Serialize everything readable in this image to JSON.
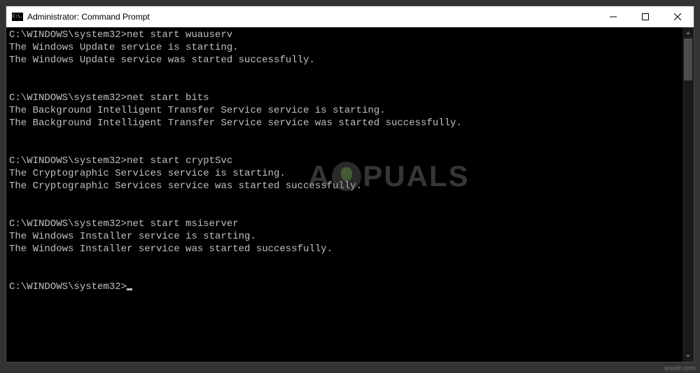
{
  "window": {
    "title": "Administrator: Command Prompt",
    "icon_label": "C:\\."
  },
  "terminal": {
    "prompt": "C:\\WINDOWS\\system32>",
    "lines": [
      {
        "type": "cmd",
        "text": "C:\\WINDOWS\\system32>net start wuauserv"
      },
      {
        "type": "out",
        "text": "The Windows Update service is starting."
      },
      {
        "type": "out",
        "text": "The Windows Update service was started successfully."
      },
      {
        "type": "blank",
        "text": ""
      },
      {
        "type": "blank",
        "text": ""
      },
      {
        "type": "cmd",
        "text": "C:\\WINDOWS\\system32>net start bits"
      },
      {
        "type": "out",
        "text": "The Background Intelligent Transfer Service service is starting."
      },
      {
        "type": "out",
        "text": "The Background Intelligent Transfer Service service was started successfully."
      },
      {
        "type": "blank",
        "text": ""
      },
      {
        "type": "blank",
        "text": ""
      },
      {
        "type": "cmd",
        "text": "C:\\WINDOWS\\system32>net start cryptSvc"
      },
      {
        "type": "out",
        "text": "The Cryptographic Services service is starting."
      },
      {
        "type": "out",
        "text": "The Cryptographic Services service was started successfully."
      },
      {
        "type": "blank",
        "text": ""
      },
      {
        "type": "blank",
        "text": ""
      },
      {
        "type": "cmd",
        "text": "C:\\WINDOWS\\system32>net start msiserver"
      },
      {
        "type": "out",
        "text": "The Windows Installer service is starting."
      },
      {
        "type": "out",
        "text": "The Windows Installer service was started successfully."
      },
      {
        "type": "blank",
        "text": ""
      },
      {
        "type": "blank",
        "text": ""
      },
      {
        "type": "prompt",
        "text": "C:\\WINDOWS\\system32>"
      }
    ]
  },
  "watermark": {
    "left": "A",
    "right": "PUALS"
  },
  "attribution": "wsxdn.com"
}
